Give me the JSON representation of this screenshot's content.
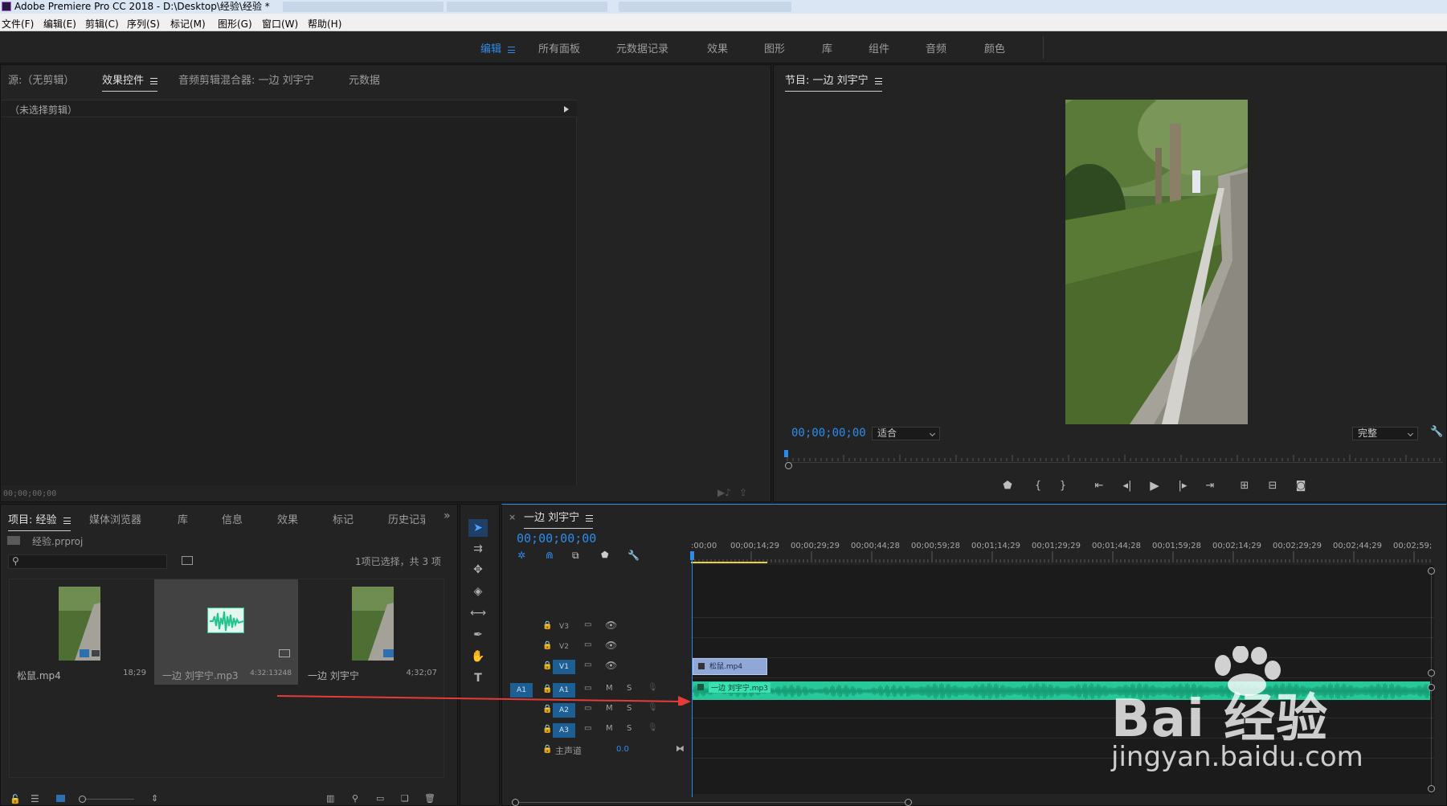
{
  "window": {
    "title": "Adobe Premiere Pro CC 2018 - D:\\Desktop\\经验\\经验 *"
  },
  "menu": [
    "文件(F)",
    "编辑(E)",
    "剪辑(C)",
    "序列(S)",
    "标记(M)",
    "图形(G)",
    "窗口(W)",
    "帮助(H)"
  ],
  "workspaces": {
    "active": "编辑",
    "items": [
      "所有面板",
      "元数据记录",
      "效果",
      "图形",
      "库",
      "组件",
      "音频",
      "颜色"
    ]
  },
  "source_panel": {
    "tabs": [
      "源:（无剪辑）",
      "效果控件",
      "音频剪辑混合器: 一边 刘宇宁",
      "元数据"
    ],
    "active_tab": "效果控件",
    "no_clip_label": "（未选择剪辑）",
    "timecode": "00;00;00;00"
  },
  "program_monitor": {
    "title": "节目: 一边 刘宇宁",
    "timecode": "00;00;00;00",
    "fit": "适合",
    "quality": "完整"
  },
  "project_panel": {
    "tabs": [
      "项目: 经验",
      "媒体浏览器",
      "库",
      "信息",
      "效果",
      "标记",
      "历史记录"
    ],
    "project_file": "经验.prproj",
    "selection_info": "1项已选择，共 3 项",
    "items": [
      {
        "name": "松鼠.mp4",
        "duration": "18;29"
      },
      {
        "name": "一边 刘宇宁.mp3",
        "duration": "4:32:13248"
      },
      {
        "name": "一边 刘宇宁",
        "duration": "4;32;07"
      }
    ]
  },
  "timeline": {
    "sequence_name": "一边 刘宇宁",
    "timecode": "00;00;00;00",
    "ruler": [
      ":00;00",
      "00;00;14;29",
      "00;00;29;29",
      "00;00;44;28",
      "00;00;59;28",
      "00;01;14;29",
      "00;01;29;29",
      "00;01;44;28",
      "00;01;59;28",
      "00;02;14;29",
      "00;02;29;29",
      "00;02;44;29",
      "00;02;59;"
    ],
    "video_tracks": [
      "V3",
      "V2",
      "V1"
    ],
    "audio_tracks": [
      "A1",
      "A2",
      "A3"
    ],
    "source_patch": "A1",
    "mix_label": "主声道",
    "mix_value": "0.0",
    "clip_video": "松鼠.mp4",
    "clip_audio": "一边 刘宇宁.mp3"
  },
  "watermark": {
    "brand": "Bai  经验",
    "url": "jingyan.baidu.com"
  },
  "colors": {
    "accent": "#2d8ceb",
    "video_clip": "#8fa8d8",
    "audio_clip": "#27c99a",
    "playhead": "#2d8ceb",
    "arrow": "#e53b3b"
  }
}
